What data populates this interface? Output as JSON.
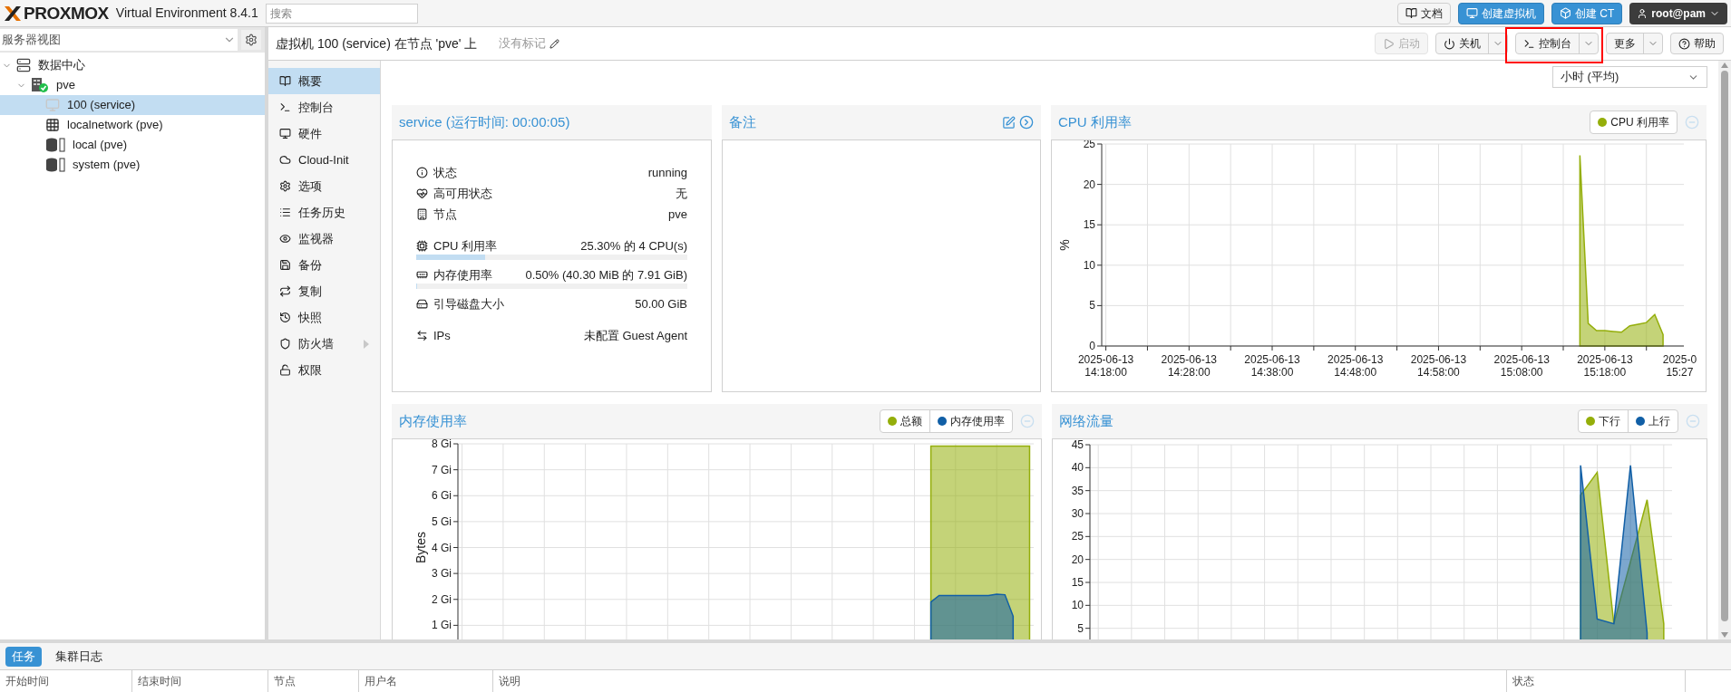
{
  "header": {
    "logo": "PROXMOX",
    "version": "Virtual Environment 8.4.1",
    "search": {
      "placeholder": "搜索"
    },
    "buttons": [
      {
        "label": "文档",
        "kind": "plain"
      },
      {
        "label": "创建虚拟机",
        "kind": "primary"
      },
      {
        "label": "创建 CT",
        "kind": "primary"
      }
    ],
    "user": "root@pam"
  },
  "sidebar": {
    "view": "服务器视图",
    "tree": [
      {
        "label": "数据中心",
        "kind": "datacenter",
        "expanded": true,
        "selected": false,
        "children": [
          {
            "label": "pve",
            "kind": "node",
            "expanded": true,
            "selected": false,
            "children": [
              {
                "label": "100 (service)",
                "kind": "vm",
                "selected": true
              },
              {
                "label": "localnetwork (pve)",
                "kind": "network",
                "selected": false
              },
              {
                "label": "local (pve)",
                "kind": "storage",
                "selected": false
              },
              {
                "label": "system (pve)",
                "kind": "storage",
                "selected": false
              }
            ]
          }
        ]
      }
    ]
  },
  "toolbar": {
    "title": "虚拟机 100 (service) 在节点 'pve' 上",
    "tags": "没有标记",
    "buttons": [
      {
        "label": "启动",
        "disabled": true,
        "menu": false
      },
      {
        "label": "关机",
        "disabled": false,
        "menu": true
      },
      {
        "label": "控制台",
        "disabled": false,
        "menu": true
      },
      {
        "label": "更多",
        "disabled": false,
        "menu": true
      },
      {
        "label": "帮助",
        "disabled": false,
        "menu": false
      }
    ]
  },
  "nav": [
    {
      "label": "概要",
      "selected": true,
      "submenu": false
    },
    {
      "label": "控制台",
      "selected": false,
      "submenu": false
    },
    {
      "label": "硬件",
      "selected": false,
      "submenu": false
    },
    {
      "label": "Cloud-Init",
      "selected": false,
      "submenu": false
    },
    {
      "label": "选项",
      "selected": false,
      "submenu": false
    },
    {
      "label": "任务历史",
      "selected": false,
      "submenu": false
    },
    {
      "label": "监视器",
      "selected": false,
      "submenu": false
    },
    {
      "label": "备份",
      "selected": false,
      "submenu": false
    },
    {
      "label": "复制",
      "selected": false,
      "submenu": false
    },
    {
      "label": "快照",
      "selected": false,
      "submenu": false
    },
    {
      "label": "防火墙",
      "selected": false,
      "submenu": true
    },
    {
      "label": "权限",
      "selected": false,
      "submenu": false
    }
  ],
  "timeframe": "小时 (平均)",
  "summary": {
    "title": "service (运行时间: 00:00:05)",
    "sections": [
      [
        {
          "kind": "text",
          "label": "状态",
          "value": "running"
        },
        {
          "kind": "text",
          "label": "高可用状态",
          "value": "无"
        },
        {
          "kind": "text",
          "label": "节点",
          "value": "pve"
        }
      ],
      [
        {
          "kind": "meter",
          "label": "CPU 利用率",
          "value": "25.30% 的 4 CPU(s)",
          "level": 0.253
        },
        {
          "kind": "meter",
          "label": "内存使用率",
          "value": "0.50% (40.30 MiB 的 7.91 GiB)",
          "level": 0.005
        },
        {
          "kind": "text",
          "label": "引导磁盘大小",
          "value": "50.00 GiB"
        }
      ],
      [
        {
          "kind": "text",
          "label": "IPs",
          "value": "未配置 Guest Agent"
        }
      ]
    ]
  },
  "notes": {
    "title": "备注"
  },
  "charts": [
    {
      "title": "CPU 利用率",
      "chart_data": {
        "type": "area",
        "grid": true,
        "ylabel": "%",
        "ylim": [
          0,
          25
        ],
        "yticks": [
          0,
          5,
          10,
          15,
          20,
          25
        ],
        "categories": [
          "2025-06-13\n14:18:00",
          null,
          null,
          null,
          null,
          null,
          null,
          null,
          null,
          null,
          "2025-06-13\n14:28:00",
          null,
          null,
          null,
          null,
          null,
          null,
          null,
          null,
          null,
          "2025-06-13\n14:38:00",
          null,
          null,
          null,
          null,
          null,
          null,
          null,
          null,
          null,
          "2025-06-13\n14:48:00",
          null,
          null,
          null,
          null,
          null,
          null,
          null,
          null,
          null,
          "2025-06-13\n14:58:00",
          null,
          null,
          null,
          null,
          null,
          null,
          null,
          null,
          null,
          "2025-06-13\n15:08:00",
          null,
          null,
          null,
          null,
          null,
          null,
          null,
          null,
          null,
          "2025-06-13\n15:18:00",
          null,
          null,
          null,
          null,
          null,
          null,
          null,
          null,
          "2025-0\n15:27"
        ],
        "series": [
          {
            "name": "CPU 利用率",
            "color": "#94ae0a",
            "values": [
              null,
              null,
              null,
              null,
              null,
              null,
              null,
              null,
              null,
              null,
              null,
              null,
              null,
              null,
              null,
              null,
              null,
              null,
              null,
              null,
              null,
              null,
              null,
              null,
              null,
              null,
              null,
              null,
              null,
              null,
              null,
              null,
              null,
              null,
              null,
              null,
              null,
              null,
              null,
              null,
              null,
              null,
              null,
              null,
              null,
              null,
              null,
              null,
              null,
              null,
              null,
              null,
              null,
              null,
              null,
              null,
              null,
              23.6,
              2.8,
              1.9,
              1.9,
              1.8,
              1.7,
              2.5,
              2.7,
              2.9,
              3.9,
              1.4,
              null,
              null
            ]
          }
        ]
      }
    },
    {
      "title": "内存使用率",
      "chart_data": {
        "type": "area",
        "grid": true,
        "ylabel": "Bytes",
        "ylim": [
          0,
          8
        ],
        "yticks": [
          {
            "value": 1,
            "label": "1 Gi"
          },
          {
            "value": 2,
            "label": "2 Gi"
          },
          {
            "value": 3,
            "label": "3 Gi"
          },
          {
            "value": 4,
            "label": "4 Gi"
          },
          {
            "value": 5,
            "label": "5 Gi"
          },
          {
            "value": 6,
            "label": "6 Gi"
          },
          {
            "value": 7,
            "label": "7 Gi"
          },
          {
            "value": 8,
            "label": "8 Gi"
          }
        ],
        "categories": [
          null,
          null,
          null,
          null,
          null,
          null,
          null,
          null,
          null,
          null,
          null,
          null,
          null,
          null,
          null,
          null,
          null,
          null,
          null,
          null,
          null,
          null,
          null,
          null,
          null,
          null,
          null,
          null,
          null,
          null,
          null,
          null,
          null,
          null,
          null,
          null,
          null,
          null,
          null,
          null,
          null,
          null,
          null,
          null,
          null,
          null,
          null,
          null,
          null,
          null,
          null,
          null,
          null,
          null,
          null,
          null,
          null,
          null,
          null,
          null,
          null,
          null,
          null,
          null,
          null,
          null,
          null,
          null,
          null,
          null
        ],
        "series": [
          {
            "name": "总额",
            "color": "#94ae0a",
            "values": [
              null,
              null,
              null,
              null,
              null,
              null,
              null,
              null,
              null,
              null,
              null,
              null,
              null,
              null,
              null,
              null,
              null,
              null,
              null,
              null,
              null,
              null,
              null,
              null,
              null,
              null,
              null,
              null,
              null,
              null,
              null,
              null,
              null,
              null,
              null,
              null,
              null,
              null,
              null,
              null,
              null,
              null,
              null,
              null,
              null,
              null,
              null,
              null,
              null,
              null,
              null,
              null,
              null,
              null,
              null,
              null,
              null,
              7.91,
              7.91,
              7.91,
              7.91,
              7.91,
              7.91,
              7.91,
              7.91,
              7.91,
              7.91,
              7.91,
              7.91,
              7.91
            ]
          },
          {
            "name": "内存使用率",
            "color": "#115fa6",
            "values": [
              null,
              null,
              null,
              null,
              null,
              null,
              null,
              null,
              null,
              null,
              null,
              null,
              null,
              null,
              null,
              null,
              null,
              null,
              null,
              null,
              null,
              null,
              null,
              null,
              null,
              null,
              null,
              null,
              null,
              null,
              null,
              null,
              null,
              null,
              null,
              null,
              null,
              null,
              null,
              null,
              null,
              null,
              null,
              null,
              null,
              null,
              null,
              null,
              null,
              null,
              null,
              null,
              null,
              null,
              null,
              null,
              null,
              1.9,
              2.15,
              2.15,
              2.15,
              2.15,
              2.15,
              2.15,
              2.15,
              2.2,
              2.18,
              1.35,
              null,
              null
            ]
          }
        ]
      }
    },
    {
      "title": "网络流量",
      "chart_data": {
        "type": "area",
        "grid": true,
        "ylim": [
          0,
          45
        ],
        "yticks": [
          5,
          10,
          15,
          20,
          25,
          30,
          35,
          40,
          45
        ],
        "categories": [
          null,
          null,
          null,
          null,
          null,
          null,
          null,
          null,
          null,
          null,
          null,
          null,
          null,
          null,
          null,
          null,
          null,
          null,
          null,
          null,
          null,
          null,
          null,
          null,
          null,
          null,
          null,
          null,
          null,
          null,
          null,
          null,
          null,
          null,
          null
        ],
        "series": [
          {
            "name": "下行",
            "color": "#94ae0a",
            "values": [
              null,
              null,
              null,
              null,
              null,
              null,
              null,
              null,
              null,
              null,
              null,
              null,
              null,
              null,
              null,
              null,
              null,
              null,
              null,
              null,
              null,
              null,
              null,
              null,
              null,
              null,
              null,
              null,
              null,
              34,
              39,
              6,
              null,
              33,
              6
            ]
          },
          {
            "name": "上行",
            "color": "#115fa6",
            "values": [
              null,
              null,
              null,
              null,
              null,
              null,
              null,
              null,
              null,
              null,
              null,
              null,
              null,
              null,
              null,
              null,
              null,
              null,
              null,
              null,
              null,
              null,
              null,
              null,
              null,
              null,
              null,
              null,
              null,
              40.5,
              7,
              6,
              40.5,
              4,
              null
            ]
          }
        ]
      }
    }
  ],
  "log_panel": {
    "tabs": [
      {
        "label": "任务",
        "selected": true
      },
      {
        "label": "集群日志",
        "selected": false
      }
    ],
    "columns": [
      "开始时间",
      "结束时间",
      "节点",
      "用户名",
      "说明",
      "状态"
    ]
  }
}
